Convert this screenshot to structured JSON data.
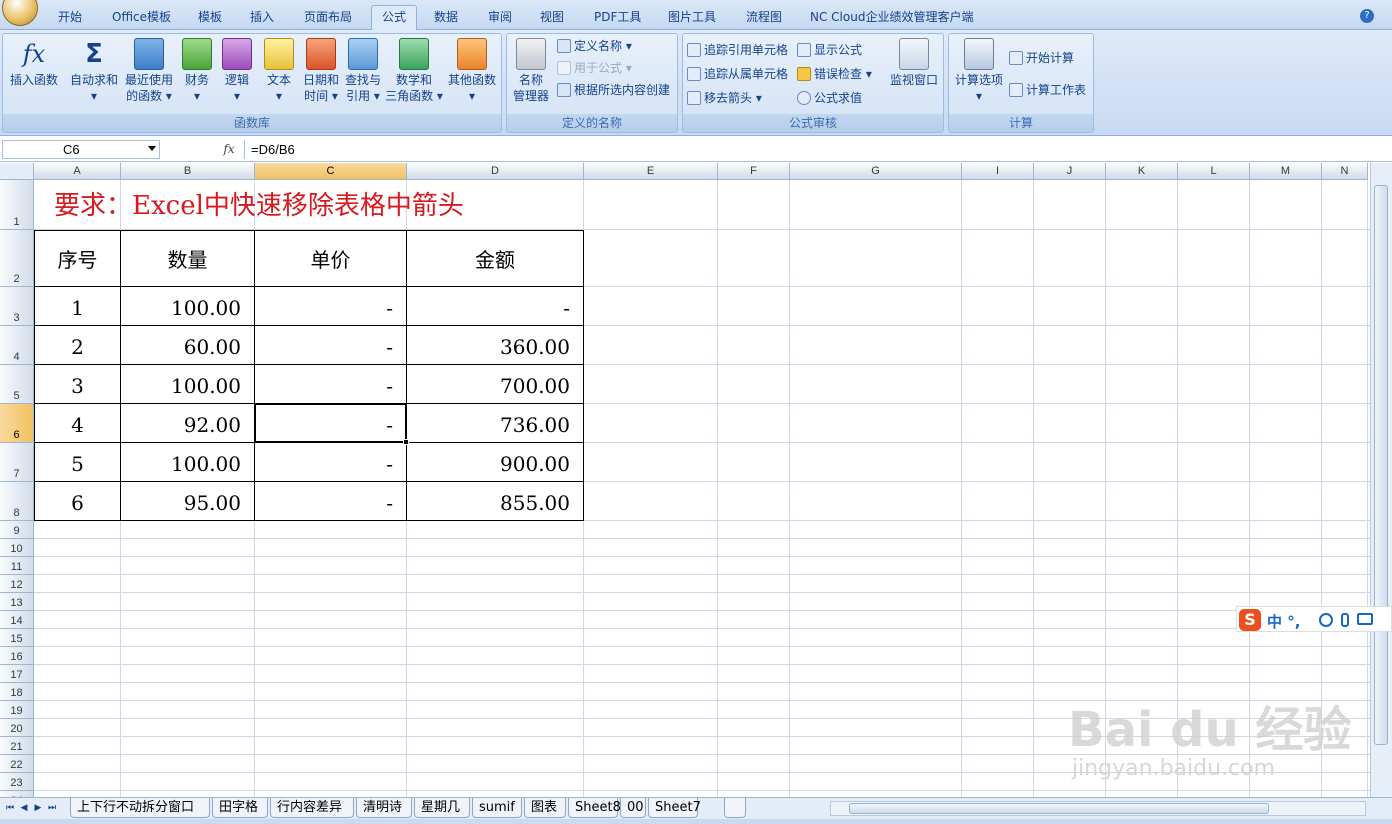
{
  "tabs": [
    "开始",
    "Office模板",
    "模板",
    "插入",
    "页面布局",
    "公式",
    "数据",
    "审阅",
    "视图",
    "PDF工具",
    "图片工具",
    "流程图",
    "NC Cloud企业绩效管理客户端"
  ],
  "active_tab": "公式",
  "ribbon": {
    "function_library": {
      "label": "函数库",
      "buttons": [
        {
          "line1": "插入函数",
          "line2": ""
        },
        {
          "line1": "自动求和",
          "line2": "▾"
        },
        {
          "line1": "最近使用",
          "line2": "的函数 ▾"
        },
        {
          "line1": "财务",
          "line2": "▾"
        },
        {
          "line1": "逻辑",
          "line2": "▾"
        },
        {
          "line1": "文本",
          "line2": "▾"
        },
        {
          "line1": "日期和",
          "line2": "时间 ▾"
        },
        {
          "line1": "查找与",
          "line2": "引用 ▾"
        },
        {
          "line1": "数学和",
          "line2": "三角函数 ▾"
        },
        {
          "line1": "其他函数",
          "line2": "▾"
        }
      ]
    },
    "defined_names": {
      "label": "定义的名称",
      "big_button": {
        "line1": "名称",
        "line2": "管理器"
      },
      "items": [
        "定义名称 ▾",
        "用于公式 ▾",
        "根据所选内容创建"
      ]
    },
    "formula_auditing": {
      "label": "公式审核",
      "left_items": [
        "追踪引用单元格",
        "追踪从属单元格",
        "移去箭头 ▾"
      ],
      "right_items": [
        "显示公式",
        "错误检查 ▾",
        "公式求值"
      ],
      "big_button": "监视窗口"
    },
    "calculation": {
      "label": "计算",
      "big_button": {
        "line1": "计算选项",
        "line2": "▾"
      },
      "items": [
        "开始计算",
        "计算工作表"
      ]
    }
  },
  "formula_bar": {
    "name_box": "C6",
    "fx": "fx",
    "formula": "=D6/B6"
  },
  "columns": [
    "A",
    "B",
    "C",
    "D",
    "E",
    "F",
    "G",
    "I",
    "J",
    "K",
    "L",
    "M",
    "N"
  ],
  "rows": [
    "1",
    "2",
    "3",
    "4",
    "5",
    "6",
    "7",
    "8",
    "9",
    "10",
    "11",
    "12",
    "13",
    "14",
    "15",
    "16",
    "17",
    "18",
    "19",
    "20",
    "21",
    "22",
    "23",
    "24"
  ],
  "selected_cell": {
    "column": "C",
    "row": "6"
  },
  "title": "要求：Excel中快速移除表格中箭头",
  "table": {
    "headers": [
      "序号",
      "数量",
      "单价",
      "金额"
    ],
    "rows": [
      [
        "1",
        "100.00",
        "-",
        "-"
      ],
      [
        "2",
        "60.00",
        "-",
        "360.00"
      ],
      [
        "3",
        "100.00",
        "-",
        "700.00"
      ],
      [
        "4",
        "92.00",
        "-",
        "736.00"
      ],
      [
        "5",
        "100.00",
        "-",
        "900.00"
      ],
      [
        "6",
        "95.00",
        "-",
        "855.00"
      ]
    ]
  },
  "sheet_tabs": [
    "上下行不动拆分窗口",
    "田字格",
    "行内容差异",
    "清明诗",
    "星期几",
    "sumif",
    "图表",
    "Sheet8",
    "00",
    "Sheet7"
  ],
  "nav_buttons": [
    "⏮",
    "◀",
    "▶",
    "⏭"
  ],
  "ime": {
    "logo": "S",
    "text": "中 °,"
  },
  "watermark": {
    "main": "Bai du 经验",
    "sub": "jingyan.baidu.com"
  }
}
